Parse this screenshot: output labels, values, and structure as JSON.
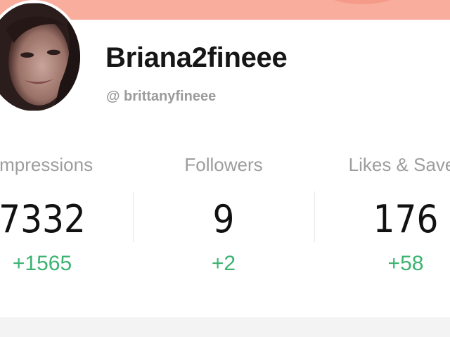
{
  "profile": {
    "username": "Briana2fineee",
    "handle": "@ brittanyfineee"
  },
  "stats": [
    {
      "label": "Impressions",
      "value": "7332",
      "delta": "+1565"
    },
    {
      "label": "Followers",
      "value": "9",
      "delta": "+2"
    },
    {
      "label": "Likes & Saves",
      "value": "176",
      "delta": "+58"
    }
  ],
  "colors": {
    "cover": "#f9ad9d",
    "delta_green": "#3cb371",
    "label_gray": "#9d9d9d"
  },
  "icons": {
    "avatar": "profile-photo"
  }
}
